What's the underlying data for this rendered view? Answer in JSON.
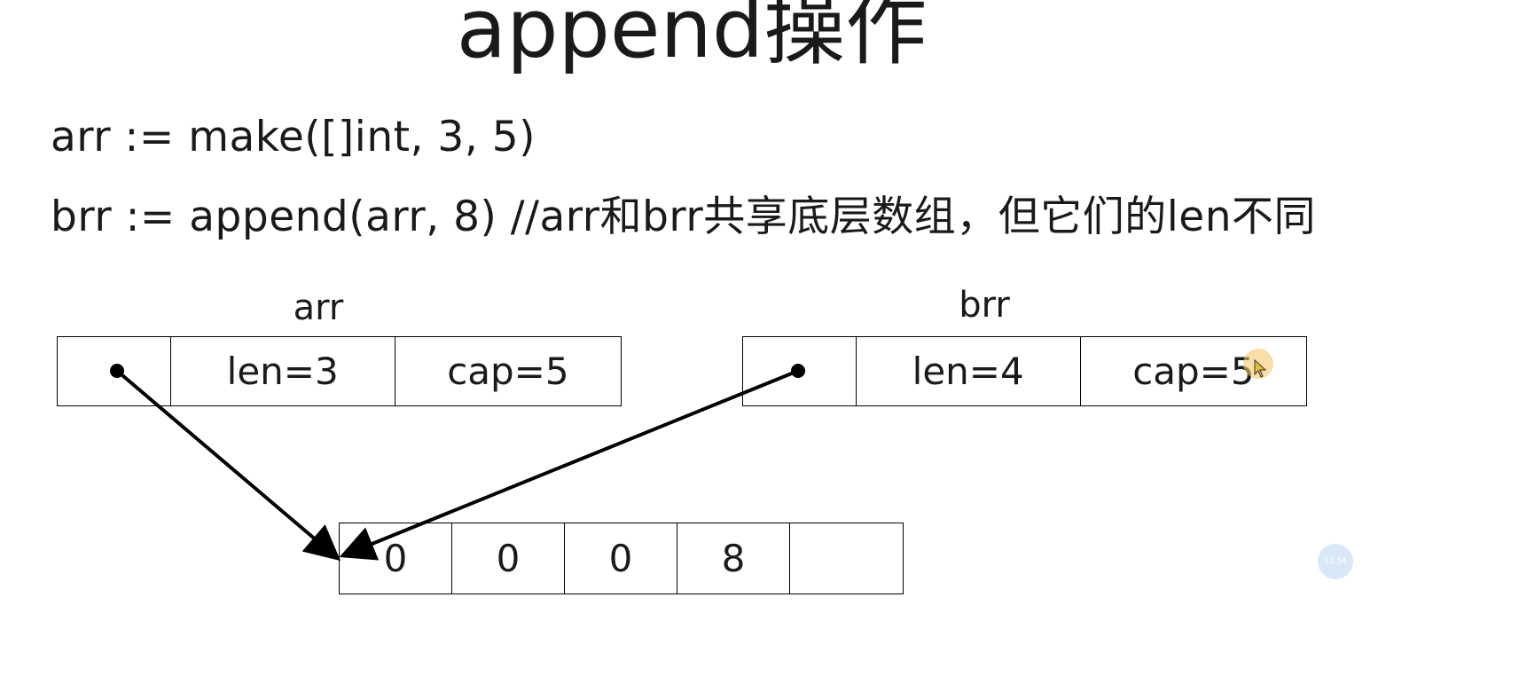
{
  "title": "append操作",
  "code": {
    "line1": "arr := make([]int, 3, 5)",
    "line2": "brr := append(arr, 8) //arr和brr共享底层数组，但它们的len不同"
  },
  "arr": {
    "label": "arr",
    "len": "len=3",
    "cap": "cap=5"
  },
  "brr": {
    "label": "brr",
    "len": "len=4",
    "cap": "cap=5"
  },
  "array": [
    "0",
    "0",
    "0",
    "8",
    ""
  ],
  "timer_badge": "11:54",
  "colors": {
    "line": "#000000",
    "text": "#1a1a1a",
    "cursor_highlight": "#f5c86e",
    "badge": "#aacdf0"
  }
}
